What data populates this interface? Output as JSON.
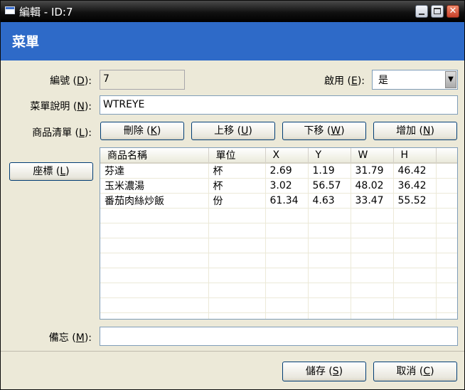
{
  "window": {
    "title": "編輯 - ID:7",
    "close_glyph": "✕"
  },
  "header": {
    "title": "菜單"
  },
  "fields": {
    "id_label": "編號 (",
    "id_key": "D",
    "id_suffix": "):",
    "id_value": "7",
    "enable_label": "啟用 (",
    "enable_key": "E",
    "enable_suffix": "):",
    "enable_value": "是",
    "desc_label": "菜單說明 (",
    "desc_key": "N",
    "desc_suffix": "):",
    "desc_value": "WTREYE",
    "items_label": "商品清單 (",
    "items_key": "L",
    "items_suffix": "):",
    "memo_label": "備忘 (",
    "memo_key": "M",
    "memo_suffix": "):",
    "memo_value": ""
  },
  "buttons": {
    "delete": {
      "text": "刪除 (",
      "key": "K",
      "end": ")"
    },
    "up": {
      "text": "上移 (",
      "key": "U",
      "end": ")"
    },
    "down": {
      "text": "下移 (",
      "key": "W",
      "end": ")"
    },
    "add": {
      "text": "增加 (",
      "key": "N",
      "end": ")"
    },
    "coords": {
      "text": "座標 (",
      "key": "L",
      "end": ")"
    },
    "save": {
      "text": "儲存 (",
      "key": "S",
      "end": ")"
    },
    "cancel": {
      "text": "取消 (",
      "key": "C",
      "end": ")"
    }
  },
  "table": {
    "columns": [
      "商品名稱",
      "單位",
      "X",
      "Y",
      "W",
      "H"
    ],
    "rows": [
      [
        "芬達",
        "杯",
        "2.69",
        "1.19",
        "31.79",
        "46.42"
      ],
      [
        "玉米濃湯",
        "杯",
        "3.02",
        "56.57",
        "48.02",
        "36.42"
      ],
      [
        "番茄肉絲炒飯",
        "份",
        "61.34",
        "4.63",
        "33.47",
        "55.52"
      ],
      [
        "",
        "",
        "",
        "",
        "",
        ""
      ],
      [
        "",
        "",
        "",
        "",
        "",
        ""
      ],
      [
        "",
        "",
        "",
        "",
        "",
        ""
      ],
      [
        "",
        "",
        "",
        "",
        "",
        ""
      ],
      [
        "",
        "",
        "",
        "",
        "",
        ""
      ],
      [
        "",
        "",
        "",
        "",
        "",
        ""
      ],
      [
        "",
        "",
        "",
        "",
        "",
        ""
      ],
      [
        "",
        "",
        "",
        "",
        "",
        ""
      ]
    ]
  },
  "colors": {
    "accent": "#2e6ac8",
    "dialog_bg": "#ece9d8"
  }
}
